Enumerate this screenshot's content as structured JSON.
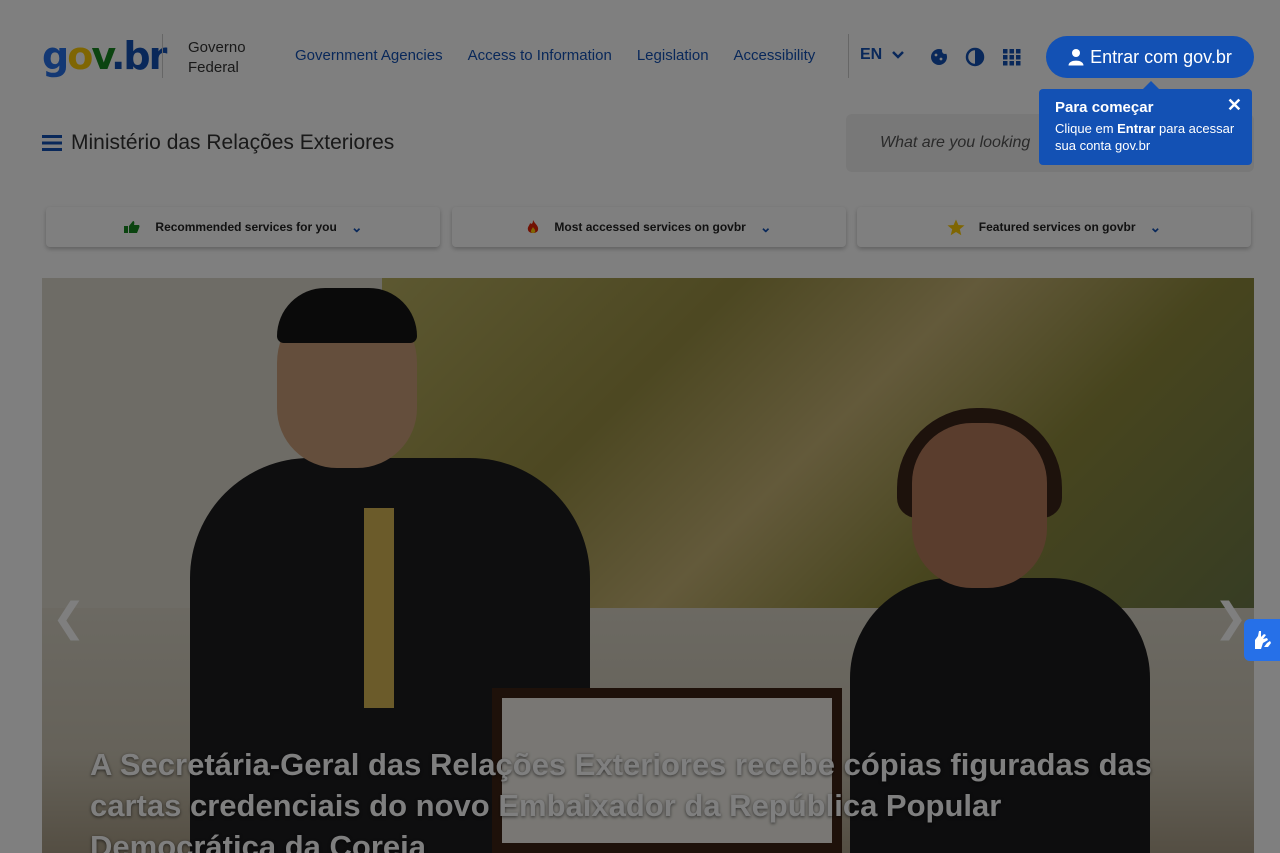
{
  "logo": {
    "g": "g",
    "o": "o",
    "v": "v",
    "dot": ".",
    "br": "br"
  },
  "header": {
    "gov_line1": "Governo",
    "gov_line2": "Federal",
    "links": [
      "Government Agencies",
      "Access to Information",
      "Legislation",
      "Accessibility"
    ],
    "language": "EN",
    "login_label": "Entrar com gov.br",
    "site_name": "Ministério das Relações Exteriores",
    "search_placeholder": "What are you looking"
  },
  "services": [
    {
      "label": "Recommended services for you",
      "icon": "thumbs-up-icon"
    },
    {
      "label": "Most accessed services on govbr",
      "icon": "fire-icon"
    },
    {
      "label": "Featured services on govbr",
      "icon": "star-icon"
    }
  ],
  "hero": {
    "title": "A Secretária-Geral das Relações Exteriores recebe cópias figuradas das cartas credenciais do novo Embaixador da República Popular Democrática da Coreia"
  },
  "tooltip": {
    "title": "Para começar",
    "body_prefix": "Clique em ",
    "body_bold": "Entrar",
    "body_suffix": " para acessar sua conta gov.br"
  },
  "colors": {
    "primary": "#1351b4",
    "accent_blue": "#2670e8",
    "yellow": "#ffcd07",
    "green": "#168821"
  }
}
